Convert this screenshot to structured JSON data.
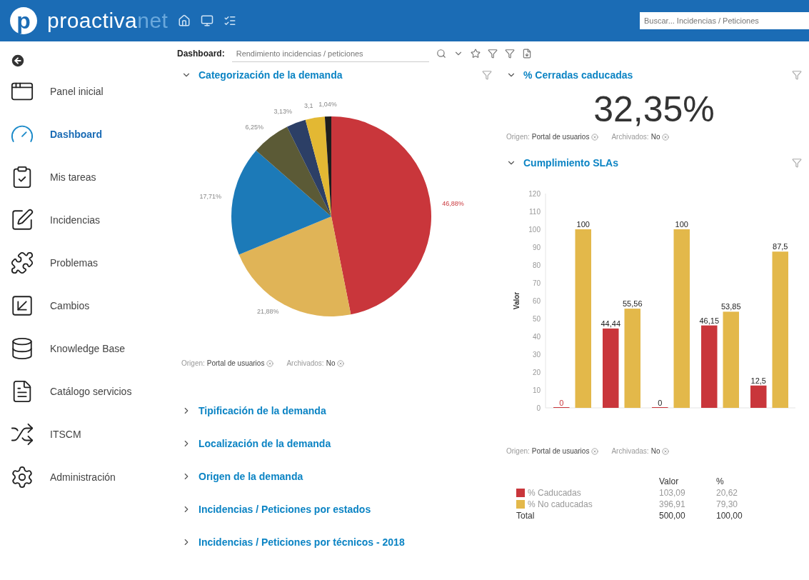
{
  "header": {
    "logo": {
      "mark": "p",
      "name": "proactiva",
      "suffix": "net"
    },
    "search": {
      "placeholder": "Buscar... Incidencias / Peticiones"
    }
  },
  "sidebar": {
    "items": [
      {
        "label": "Panel inicial",
        "selected": false
      },
      {
        "label": "Dashboard",
        "selected": true
      },
      {
        "label": "Mis tareas",
        "selected": false
      },
      {
        "label": "Incidencias",
        "selected": false
      },
      {
        "label": "Problemas",
        "selected": false
      },
      {
        "label": "Cambios",
        "selected": false
      },
      {
        "label": "Knowledge Base",
        "selected": false
      },
      {
        "label": "Catálogo servicios",
        "selected": false
      },
      {
        "label": "ITSCM",
        "selected": false
      },
      {
        "label": "Administración",
        "selected": false
      }
    ]
  },
  "toolbar": {
    "label": "Dashboard:",
    "dashboard": "Rendimiento incidencias / peticiones"
  },
  "left_sections": [
    {
      "title": "Categorización de la demanda",
      "expanded": true,
      "chart_data": {
        "type": "pie",
        "values": [
          46.88,
          21.88,
          17.71,
          6.25,
          3.13,
          3.13,
          1.04
        ],
        "colors": [
          "#c9363b",
          "#e0b457",
          "#1c7ab8",
          "#5b5a36",
          "#2c3f66",
          "#e3b833",
          "#1e1e1e"
        ],
        "value_labels": [
          "46,88%",
          "21,88%",
          "17,71%",
          "6,25%",
          "3,13%",
          "3,1",
          "1,04%"
        ]
      },
      "filters": [
        {
          "label": "Origen:",
          "value": "Portal de usuarios"
        },
        {
          "label": "Archivados:",
          "value": "No"
        }
      ]
    },
    {
      "title": "Tipificación de la demanda",
      "expanded": false
    },
    {
      "title": "Localización de la demanda",
      "expanded": false
    },
    {
      "title": "Origen de la demanda",
      "expanded": false
    },
    {
      "title": "Incidencias / Peticiones por estados",
      "expanded": false
    },
    {
      "title": "Incidencias / Peticiones por técnicos - 2018",
      "expanded": false
    }
  ],
  "kpi_section": {
    "title": "% Cerradas caducadas",
    "expanded": true,
    "value": "32,35%",
    "filters": [
      {
        "label": "Origen:",
        "value": "Portal de usuarios"
      },
      {
        "label": "Archivados:",
        "value": "No"
      }
    ]
  },
  "sla_section": {
    "title": "Cumplimiento SLAs",
    "expanded": true,
    "chart_data": {
      "type": "bar",
      "ylabel": "Valor",
      "categories": [
        null,
        null,
        null,
        null,
        null
      ],
      "ylim": [
        0,
        120
      ],
      "yticks": [
        0,
        10,
        20,
        30,
        40,
        50,
        60,
        70,
        80,
        90,
        100,
        110,
        120
      ],
      "series": [
        {
          "name": "% Caducadas",
          "color": "#c9363b",
          "values": [
            0,
            44.44,
            0,
            46.15,
            12.5
          ]
        },
        {
          "name": "% No caducadas",
          "color": "#e3b84a",
          "values": [
            100,
            55.56,
            100,
            53.85,
            87.5
          ]
        }
      ],
      "value_labels": [
        [
          "0",
          "44,44",
          "0",
          "46,15",
          "12,5"
        ],
        [
          "100",
          "55,56",
          "100",
          "53,85",
          "87,5"
        ]
      ]
    },
    "filters": [
      {
        "label": "Origen:",
        "value": "Portal de usuarios"
      },
      {
        "label": "Archivadas:",
        "value": "No"
      }
    ],
    "legend": {
      "columns": [
        "Valor",
        "%"
      ],
      "rows": [
        {
          "value": "103,09",
          "percent": "20,62"
        },
        {
          "value": "396,91",
          "percent": "79,30"
        }
      ],
      "total": {
        "label": "Total",
        "value": "500,00",
        "percent": "100,00"
      }
    }
  }
}
